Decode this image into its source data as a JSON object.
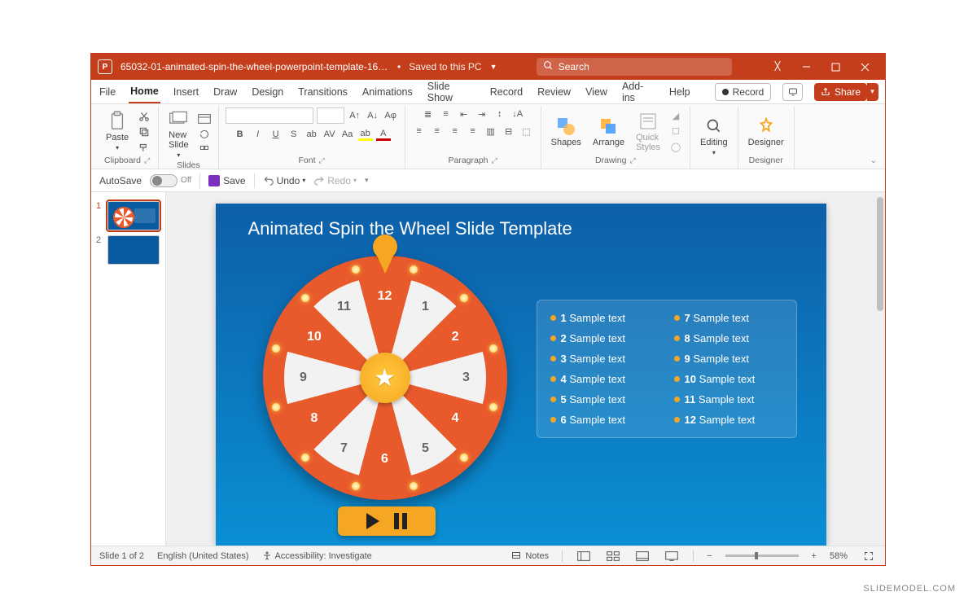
{
  "titlebar": {
    "doc_title": "65032-01-animated-spin-the-wheel-powerpoint-template-16x9-...",
    "saved_status": "Saved to this PC",
    "search_placeholder": "Search"
  },
  "tabs": [
    "File",
    "Home",
    "Insert",
    "Draw",
    "Design",
    "Transitions",
    "Animations",
    "Slide Show",
    "Record",
    "Review",
    "View",
    "Add-ins",
    "Help"
  ],
  "active_tab": "Home",
  "right_buttons": {
    "record": "Record",
    "share": "Share"
  },
  "ribbon": {
    "paste": "Paste",
    "new_slide": "New\nSlide",
    "shapes": "Shapes",
    "arrange": "Arrange",
    "quick": "Quick\nStyles",
    "editing": "Editing",
    "designer": "Designer",
    "groups": [
      "Clipboard",
      "Slides",
      "Font",
      "Paragraph",
      "Drawing",
      "Editing",
      "Designer"
    ]
  },
  "qat": {
    "autosave": "AutoSave",
    "autosave_state": "Off",
    "save": "Save",
    "undo": "Undo",
    "redo": "Redo"
  },
  "thumbnails": [
    {
      "num": "1"
    },
    {
      "num": "2"
    }
  ],
  "slide": {
    "title": "Animated Spin the Wheel Slide Template",
    "numbers": [
      "12",
      "1",
      "2",
      "3",
      "4",
      "5",
      "6",
      "7",
      "8",
      "9",
      "10",
      "11"
    ],
    "legend": [
      {
        "n": "1",
        "t": "Sample text"
      },
      {
        "n": "7",
        "t": "Sample text"
      },
      {
        "n": "2",
        "t": "Sample text"
      },
      {
        "n": "8",
        "t": "Sample text"
      },
      {
        "n": "3",
        "t": "Sample text"
      },
      {
        "n": "9",
        "t": "Sample text"
      },
      {
        "n": "4",
        "t": "Sample text"
      },
      {
        "n": "10",
        "t": "Sample text"
      },
      {
        "n": "5",
        "t": "Sample text"
      },
      {
        "n": "11",
        "t": "Sample text"
      },
      {
        "n": "6",
        "t": "Sample text"
      },
      {
        "n": "12",
        "t": "Sample text"
      }
    ]
  },
  "statusbar": {
    "slide_of": "Slide 1 of 2",
    "language": "English (United States)",
    "accessibility": "Accessibility: Investigate",
    "notes": "Notes",
    "zoom": "58%"
  },
  "watermark": "SLIDEMODEL.COM"
}
